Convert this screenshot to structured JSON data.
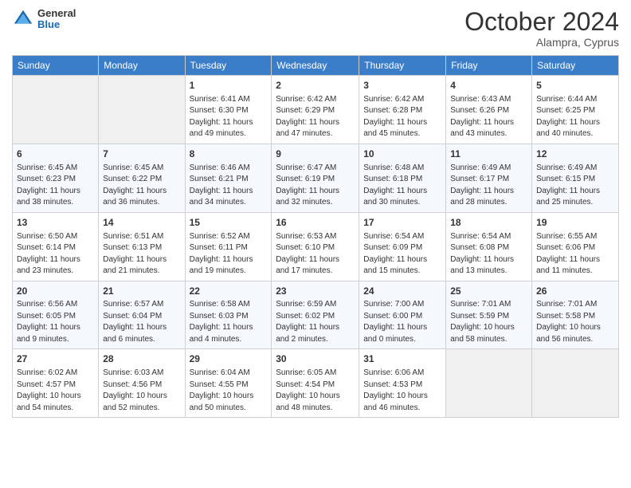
{
  "header": {
    "logo": {
      "general": "General",
      "blue": "Blue"
    },
    "month": "October 2024",
    "location": "Alampra, Cyprus"
  },
  "days_of_week": [
    "Sunday",
    "Monday",
    "Tuesday",
    "Wednesday",
    "Thursday",
    "Friday",
    "Saturday"
  ],
  "weeks": [
    [
      {
        "day": "",
        "empty": true
      },
      {
        "day": "",
        "empty": true
      },
      {
        "day": "1",
        "sunrise": "6:41 AM",
        "sunset": "6:30 PM",
        "daylight": "11 hours and 49 minutes."
      },
      {
        "day": "2",
        "sunrise": "6:42 AM",
        "sunset": "6:29 PM",
        "daylight": "11 hours and 47 minutes."
      },
      {
        "day": "3",
        "sunrise": "6:42 AM",
        "sunset": "6:28 PM",
        "daylight": "11 hours and 45 minutes."
      },
      {
        "day": "4",
        "sunrise": "6:43 AM",
        "sunset": "6:26 PM",
        "daylight": "11 hours and 43 minutes."
      },
      {
        "day": "5",
        "sunrise": "6:44 AM",
        "sunset": "6:25 PM",
        "daylight": "11 hours and 40 minutes."
      }
    ],
    [
      {
        "day": "6",
        "sunrise": "6:45 AM",
        "sunset": "6:23 PM",
        "daylight": "11 hours and 38 minutes."
      },
      {
        "day": "7",
        "sunrise": "6:45 AM",
        "sunset": "6:22 PM",
        "daylight": "11 hours and 36 minutes."
      },
      {
        "day": "8",
        "sunrise": "6:46 AM",
        "sunset": "6:21 PM",
        "daylight": "11 hours and 34 minutes."
      },
      {
        "day": "9",
        "sunrise": "6:47 AM",
        "sunset": "6:19 PM",
        "daylight": "11 hours and 32 minutes."
      },
      {
        "day": "10",
        "sunrise": "6:48 AM",
        "sunset": "6:18 PM",
        "daylight": "11 hours and 30 minutes."
      },
      {
        "day": "11",
        "sunrise": "6:49 AM",
        "sunset": "6:17 PM",
        "daylight": "11 hours and 28 minutes."
      },
      {
        "day": "12",
        "sunrise": "6:49 AM",
        "sunset": "6:15 PM",
        "daylight": "11 hours and 25 minutes."
      }
    ],
    [
      {
        "day": "13",
        "sunrise": "6:50 AM",
        "sunset": "6:14 PM",
        "daylight": "11 hours and 23 minutes."
      },
      {
        "day": "14",
        "sunrise": "6:51 AM",
        "sunset": "6:13 PM",
        "daylight": "11 hours and 21 minutes."
      },
      {
        "day": "15",
        "sunrise": "6:52 AM",
        "sunset": "6:11 PM",
        "daylight": "11 hours and 19 minutes."
      },
      {
        "day": "16",
        "sunrise": "6:53 AM",
        "sunset": "6:10 PM",
        "daylight": "11 hours and 17 minutes."
      },
      {
        "day": "17",
        "sunrise": "6:54 AM",
        "sunset": "6:09 PM",
        "daylight": "11 hours and 15 minutes."
      },
      {
        "day": "18",
        "sunrise": "6:54 AM",
        "sunset": "6:08 PM",
        "daylight": "11 hours and 13 minutes."
      },
      {
        "day": "19",
        "sunrise": "6:55 AM",
        "sunset": "6:06 PM",
        "daylight": "11 hours and 11 minutes."
      }
    ],
    [
      {
        "day": "20",
        "sunrise": "6:56 AM",
        "sunset": "6:05 PM",
        "daylight": "11 hours and 9 minutes."
      },
      {
        "day": "21",
        "sunrise": "6:57 AM",
        "sunset": "6:04 PM",
        "daylight": "11 hours and 6 minutes."
      },
      {
        "day": "22",
        "sunrise": "6:58 AM",
        "sunset": "6:03 PM",
        "daylight": "11 hours and 4 minutes."
      },
      {
        "day": "23",
        "sunrise": "6:59 AM",
        "sunset": "6:02 PM",
        "daylight": "11 hours and 2 minutes."
      },
      {
        "day": "24",
        "sunrise": "7:00 AM",
        "sunset": "6:00 PM",
        "daylight": "11 hours and 0 minutes."
      },
      {
        "day": "25",
        "sunrise": "7:01 AM",
        "sunset": "5:59 PM",
        "daylight": "10 hours and 58 minutes."
      },
      {
        "day": "26",
        "sunrise": "7:01 AM",
        "sunset": "5:58 PM",
        "daylight": "10 hours and 56 minutes."
      }
    ],
    [
      {
        "day": "27",
        "sunrise": "6:02 AM",
        "sunset": "4:57 PM",
        "daylight": "10 hours and 54 minutes."
      },
      {
        "day": "28",
        "sunrise": "6:03 AM",
        "sunset": "4:56 PM",
        "daylight": "10 hours and 52 minutes."
      },
      {
        "day": "29",
        "sunrise": "6:04 AM",
        "sunset": "4:55 PM",
        "daylight": "10 hours and 50 minutes."
      },
      {
        "day": "30",
        "sunrise": "6:05 AM",
        "sunset": "4:54 PM",
        "daylight": "10 hours and 48 minutes."
      },
      {
        "day": "31",
        "sunrise": "6:06 AM",
        "sunset": "4:53 PM",
        "daylight": "10 hours and 46 minutes."
      },
      {
        "day": "",
        "empty": true
      },
      {
        "day": "",
        "empty": true
      }
    ]
  ]
}
